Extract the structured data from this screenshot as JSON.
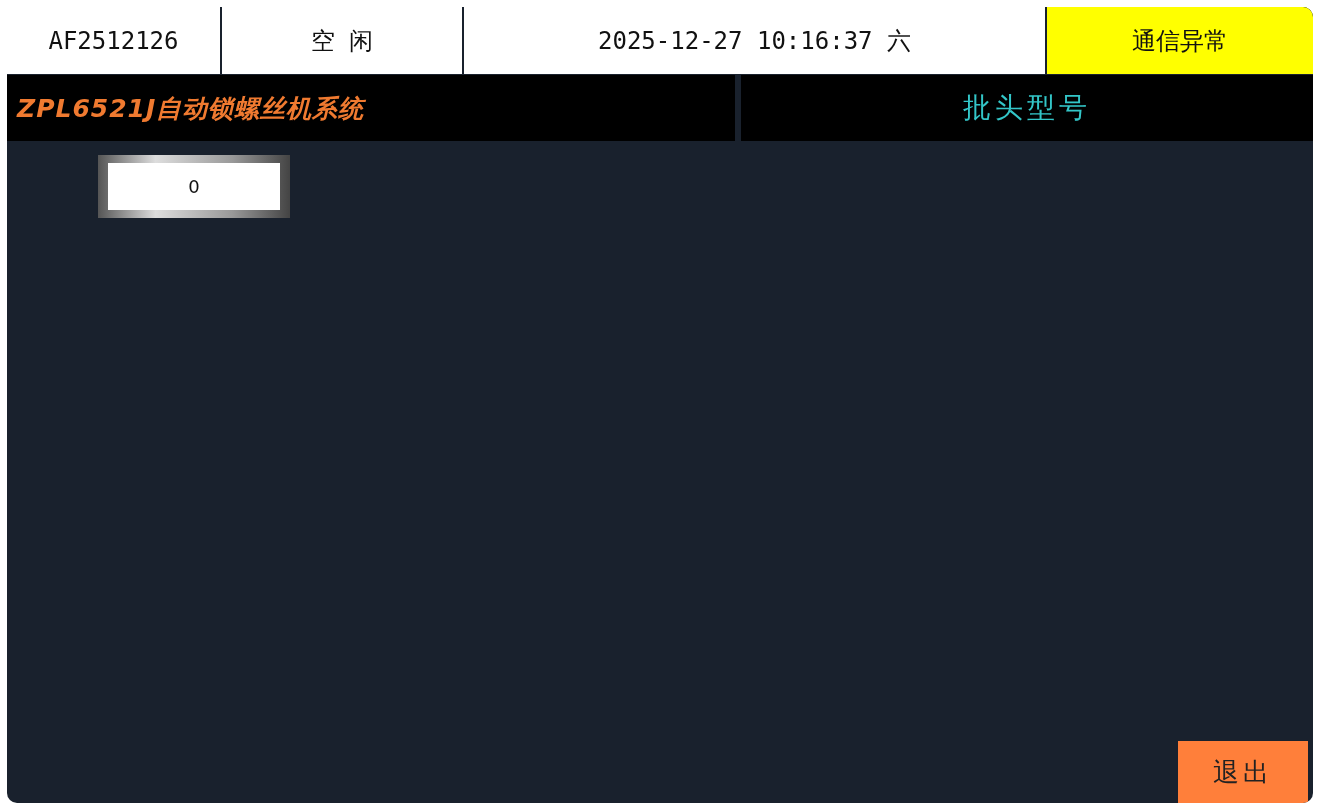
{
  "header_cells": [
    {
      "text": "AF2512126",
      "color": "#ffffff"
    },
    {
      "text": "空 闲",
      "color": "#ffffff"
    },
    {
      "text": "2025-12-27 10:16:37 六",
      "color": "#ffffff"
    },
    {
      "text": "通信异常",
      "color": "#ffff00"
    }
  ],
  "system_title": "ZPL6521J自动锁螺丝机系统",
  "section_title": "批头型号",
  "value_field": {
    "value": "0"
  },
  "exit_button": "退出"
}
